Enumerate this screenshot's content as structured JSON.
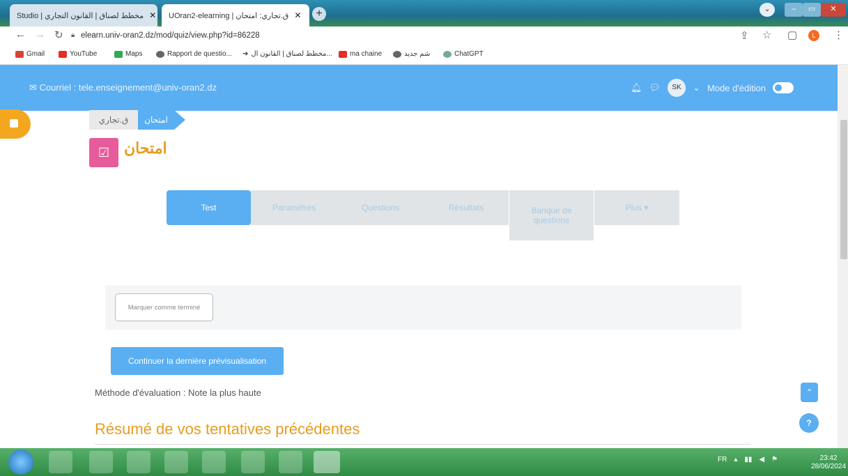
{
  "browser": {
    "tabs": [
      {
        "label": "Studio | مخطط لصناق | القانون التجاري",
        "active": false
      },
      {
        "label": "UOran2-elearning | ق.تجاري: امتحان",
        "active": true
      }
    ],
    "new_tab": "+",
    "url": "elearn.univ-oran2.dz/mod/quiz/view.php?id=86228",
    "bookmarks": [
      "Gmail",
      "YouTube",
      "Maps",
      "Rapport de questio...",
      "مخطط لصناق | القانون ال...",
      "ma chaine",
      "شم جديد",
      "ChatGPT"
    ],
    "profile_initial": "L"
  },
  "header": {
    "email": "Courriel : tele.enseignement@univ-oran2.dz",
    "avatar": "SK",
    "edit_mode": "Mode d'édition"
  },
  "breadcrumb": {
    "course": "ق.تجاري",
    "current": "امتحان"
  },
  "page": {
    "title": "امتحان"
  },
  "nav": [
    "Test",
    "Paramètres",
    "Questions",
    "Résultats",
    "Banque de questions",
    "Plus ▾"
  ],
  "completion": {
    "mark_done": "Marquer comme terminé"
  },
  "actions": {
    "continue": "Continuer la dernière prévisualisation"
  },
  "grading": "Méthode d'évaluation : Note la plus haute",
  "summary_heading": "Résumé de vos tentatives précédentes",
  "taskbar": {
    "lang": "FR",
    "time": "23:42",
    "date": "28/06/2024"
  },
  "colors": {
    "accent": "#5aaef2",
    "title": "#e79c1f",
    "quiz_icon": "#e65b9a",
    "drawer": "#f3a71f"
  },
  "icons": [
    "mail-icon",
    "bell-icon",
    "chat-icon",
    "chevron-down-icon",
    "arrow-up-icon",
    "help-icon"
  ]
}
